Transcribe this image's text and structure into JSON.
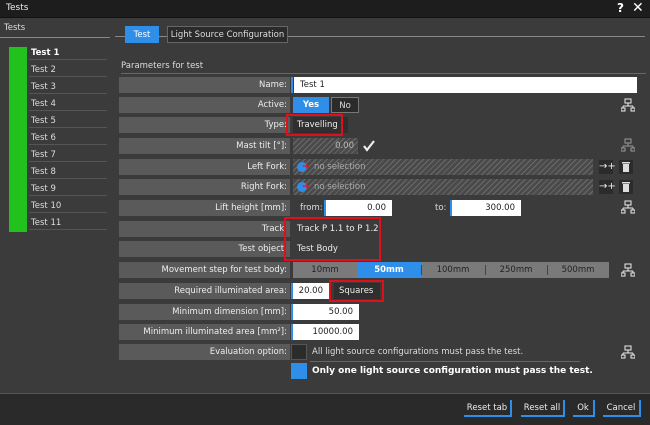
{
  "window": {
    "title": "Tests",
    "help": "?",
    "close": "✕"
  },
  "left_panel": {
    "title": "Tests",
    "tests": [
      "Test 1",
      "Test 2",
      "Test 3",
      "Test 4",
      "Test 5",
      "Test 6",
      "Test 7",
      "Test 8",
      "Test 9",
      "Test 10",
      "Test 11"
    ],
    "selected": "Test 1"
  },
  "tabs": [
    {
      "label": "Test",
      "active": true
    },
    {
      "label": "Light Source Configuration",
      "active": false
    }
  ],
  "params_title": "Parameters for test",
  "fields": {
    "name": {
      "label": "Name:",
      "value": "Test 1"
    },
    "active": {
      "label": "Active:",
      "yes": "Yes",
      "no": "No"
    },
    "type": {
      "label": "Type:",
      "value": "Travelling"
    },
    "mast_tilt": {
      "label": "Mast tilt [°]:",
      "value": "0.00"
    },
    "left_fork": {
      "label": "Left Fork:",
      "value": "no selection"
    },
    "right_fork": {
      "label": "Right Fork:",
      "value": "no selection"
    },
    "lift_height": {
      "label": "Lift height [mm]:",
      "from_label": "from:",
      "from": "0.00",
      "to_label": "to:",
      "to": "300.00"
    },
    "track": {
      "label": "Track:",
      "value": "Track P 1.1 to P 1.2"
    },
    "test_object": {
      "label": "Test object:",
      "value": "Test Body"
    },
    "movement_step": {
      "label": "Movement step for test body:",
      "options": [
        "10mm",
        "50mm",
        "100mm",
        "250mm",
        "500mm"
      ],
      "selected": "50mm"
    },
    "required_area": {
      "label": "Required illuminated area:",
      "value": "20.00",
      "unit": "Squares"
    },
    "min_dimension": {
      "label": "Minimum dimension [mm]:",
      "value": "50.00"
    },
    "min_area": {
      "label": "Minimum illuminated area [mm²]:",
      "value": "10000.00"
    },
    "evaluation": {
      "label": "Evaluation option:",
      "opt1": "All light source configurations must pass the test.",
      "opt2": "Only one light source configuration must pass the test."
    }
  },
  "footer": {
    "reset_tab": "Reset tab",
    "reset_all": "Reset all",
    "ok": "Ok",
    "cancel": "Cancel"
  },
  "colors": {
    "accent": "#2f8fe8",
    "highlight": "#e0101a",
    "status_green": "#22c21e"
  }
}
